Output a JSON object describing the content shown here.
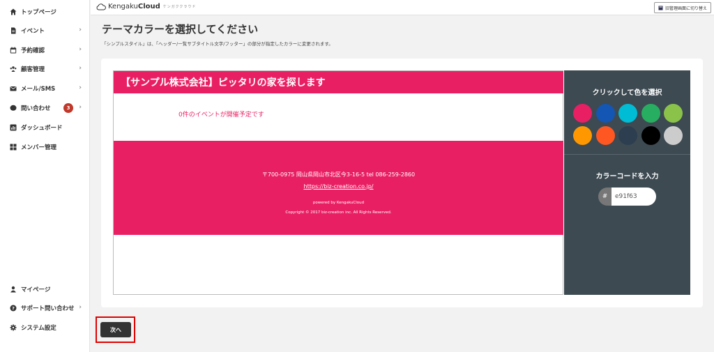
{
  "sidebar": {
    "items": [
      {
        "label": "トップページ",
        "icon": "home-icon",
        "chevron": ""
      },
      {
        "label": "イベント",
        "icon": "document-icon",
        "chevron": "›"
      },
      {
        "label": "予約確認",
        "icon": "calendar-icon",
        "chevron": "›"
      },
      {
        "label": "顧客管理",
        "icon": "customers-icon",
        "chevron": "›"
      },
      {
        "label": "メール/SMS",
        "icon": "mail-icon",
        "chevron": "›"
      },
      {
        "label": "問い合わせ",
        "icon": "chat-icon",
        "chevron": "›",
        "badge": "3"
      },
      {
        "label": "ダッシュボード",
        "icon": "chart-icon",
        "chevron": ""
      },
      {
        "label": "メンバー管理",
        "icon": "grid-icon",
        "chevron": ""
      }
    ],
    "bottom_items": [
      {
        "label": "マイページ",
        "icon": "user-icon",
        "chevron": ""
      },
      {
        "label": "サポート問い合わせ",
        "icon": "help-icon",
        "chevron": "›"
      },
      {
        "label": "システム設定",
        "icon": "gear-icon",
        "chevron": ""
      }
    ]
  },
  "topbar": {
    "logo_prefix": "Kengaku",
    "logo_bold": "Cloud",
    "logo_tag": "ケンガククラウド",
    "switch_label": "旧管理画面に切り替え"
  },
  "page": {
    "title": "テーマカラーを選択してください",
    "description": "「シンプルスタイル」は、「ヘッダー/一覧サブタイトル文字/フッター」の部分が指定したカラーに変更されます。"
  },
  "preview": {
    "header_title": "【サンプル株式会社】ピッタリの家を探します",
    "empty_message": "0件のイベントが開催予定です",
    "footer_address": "〒700-0975 岡山県岡山市北区今3-16-5 tel 086-259-2860",
    "footer_url": "https://biz-creation.co.jp/",
    "footer_powered": "powered by KengakuCloud",
    "footer_copyright": "Copyright © 2017 biz-creation inc. All Rights Reserved."
  },
  "color_panel": {
    "select_title": "クリックして色を選択",
    "swatches": [
      "#e91f63",
      "#1356b3",
      "#00bcd4",
      "#27ae60",
      "#8bc34a",
      "#ff9800",
      "#ff5722",
      "#2c3e50",
      "#000000",
      "#cccccc"
    ],
    "code_title": "カラーコードを入力",
    "hash": "#",
    "code_value": "e91f63"
  },
  "theme_color": "#e91f63",
  "next_label": "次へ"
}
